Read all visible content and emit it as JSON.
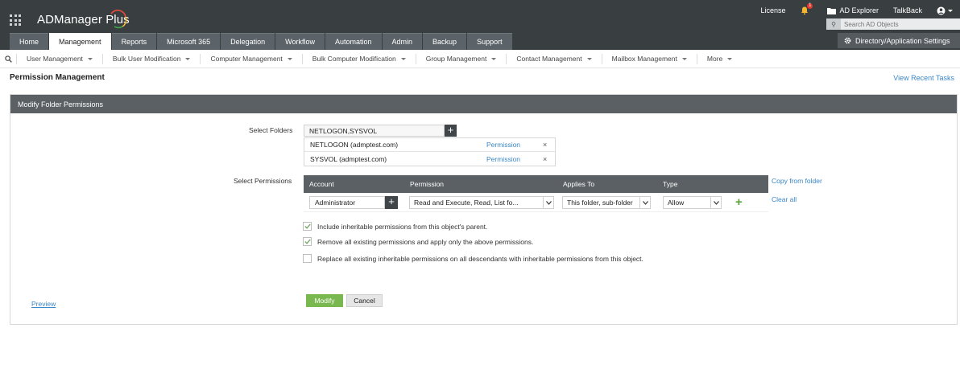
{
  "app": {
    "name": "ADManager Plus"
  },
  "top_links": {
    "license": "License",
    "notif_count": "1",
    "ad_explorer": "AD Explorer",
    "talkback": "TalkBack"
  },
  "search": {
    "placeholder": "Search AD Objects"
  },
  "dir_settings": "Directory/Application Settings",
  "tabs": [
    {
      "label": "Home"
    },
    {
      "label": "Management"
    },
    {
      "label": "Reports"
    },
    {
      "label": "Microsoft 365"
    },
    {
      "label": "Delegation"
    },
    {
      "label": "Workflow"
    },
    {
      "label": "Automation"
    },
    {
      "label": "Admin"
    },
    {
      "label": "Backup"
    },
    {
      "label": "Support"
    }
  ],
  "active_tab": "Management",
  "subnav": [
    {
      "label": "User Management"
    },
    {
      "label": "Bulk User Modification"
    },
    {
      "label": "Computer Management"
    },
    {
      "label": "Bulk Computer Modification"
    },
    {
      "label": "Group Management"
    },
    {
      "label": "Contact Management"
    },
    {
      "label": "Mailbox Management"
    },
    {
      "label": "More"
    }
  ],
  "page": {
    "title": "Permission Management",
    "recent_tasks": "View Recent Tasks"
  },
  "panel": {
    "title": "Modify Folder Permissions",
    "select_folders_label": "Select Folders",
    "folders_value": "NETLOGON,SYSVOL",
    "folders": [
      {
        "name": "NETLOGON (admptest.com)",
        "action": "Permission",
        "remove": "×"
      },
      {
        "name": "SYSVOL (admptest.com)",
        "action": "Permission",
        "remove": "×"
      }
    ],
    "select_permissions_label": "Select Permissions",
    "table": {
      "headers": {
        "account": "Account",
        "permission": "Permission",
        "applies_to": "Applies To",
        "type": "Type"
      },
      "row": {
        "account": "Administrator",
        "permission": "Read and Execute, Read, List fo...",
        "applies_to": "This folder, sub-folder",
        "type": "Allow"
      }
    },
    "copy_from_folder": "Copy from folder",
    "clear_all": "Clear all",
    "options": [
      {
        "label": "Include inheritable permissions from this object's parent.",
        "checked": true
      },
      {
        "label": "Remove all existing permissions and apply only the above permissions.",
        "checked": true
      },
      {
        "label": "Replace all existing inheritable permissions on all descendants with inheritable permissions from this object.",
        "checked": false
      }
    ],
    "modify": "Modify",
    "cancel": "Cancel",
    "preview": "Preview"
  },
  "colors": {
    "header": "#393e41",
    "tab": "#5c6368",
    "link": "#3b87c6",
    "primary_button": "#78b84e",
    "add_green": "#5aa43a"
  }
}
